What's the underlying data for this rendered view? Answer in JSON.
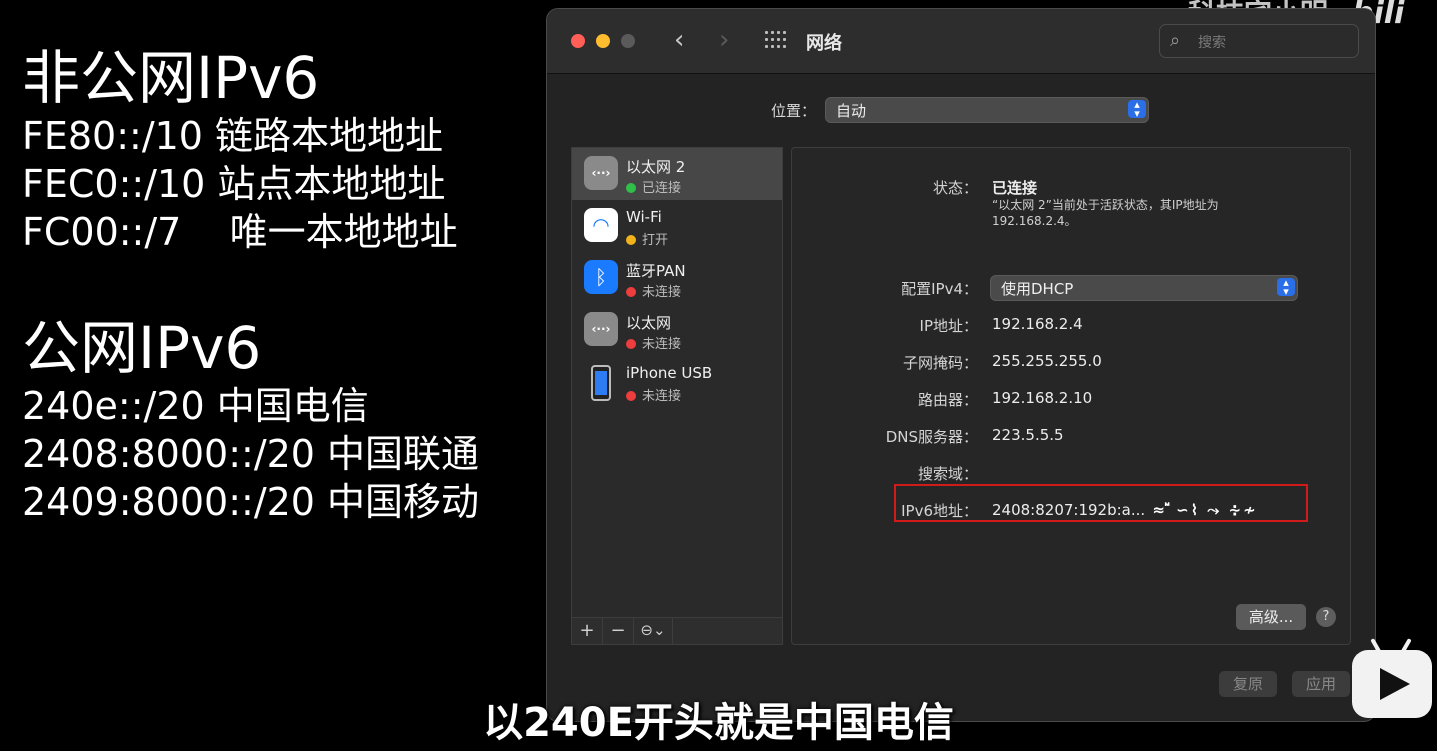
{
  "slide": {
    "heading1": "非公网IPv6",
    "lines1": [
      "FE80::/10 链路本地地址",
      "FEC0::/10 站点本地地址",
      "FC00::/7    唯一本地地址"
    ],
    "heading2": "公网IPv6",
    "lines2": [
      "240e::/20 中国电信",
      "2408:8000::/20 中国联通",
      "2409:8000::/20 中国移动"
    ]
  },
  "watermark": {
    "channel": "科技宅小明",
    "site": "bili"
  },
  "window": {
    "title": "网络",
    "search_placeholder": "搜索",
    "location": {
      "label": "位置：",
      "value": "自动"
    },
    "services": [
      {
        "name": "以太网 2",
        "status": "已连接",
        "status_color": "#30c04a",
        "icon": "ethernet-icon",
        "selected": true
      },
      {
        "name": "Wi-Fi",
        "status": "打开",
        "status_color": "#f2b21a",
        "icon": "wifi-icon"
      },
      {
        "name": "蓝牙PAN",
        "status": "未连接",
        "status_color": "#ee3d3d",
        "icon": "bluetooth-icon"
      },
      {
        "name": "以太网",
        "status": "未连接",
        "status_color": "#ee3d3d",
        "icon": "ethernet-icon"
      },
      {
        "name": "iPhone USB",
        "status": "未连接",
        "status_color": "#ee3d3d",
        "icon": "iphone-icon"
      }
    ],
    "sidebar_buttons": {
      "add": "+",
      "remove": "−",
      "action": "⊖⌄"
    },
    "detail": {
      "status_label": "状态：",
      "status_value": "已连接",
      "status_desc": "“以太网 2”当前处于活跃状态，其IP地址为192.168.2.4。",
      "configure_label": "配置IPv4：",
      "configure_value": "使用DHCP",
      "ip_label": "IP地址：",
      "ip_value": "192.168.2.4",
      "mask_label": "子网掩码：",
      "mask_value": "255.255.255.0",
      "router_label": "路由器：",
      "router_value": "192.168.2.10",
      "dns_label": "DNS服务器：",
      "dns_value": "223.5.5.5",
      "search_label": "搜索域：",
      "search_value": "",
      "ipv6_label": "IPv6地址：",
      "ipv6_value": "2408:8207:192b:a...",
      "advanced": "高级...",
      "help": "?"
    },
    "footer": {
      "revert": "复原",
      "apply": "应用"
    }
  },
  "subtitle": "以240E开头就是中国电信"
}
